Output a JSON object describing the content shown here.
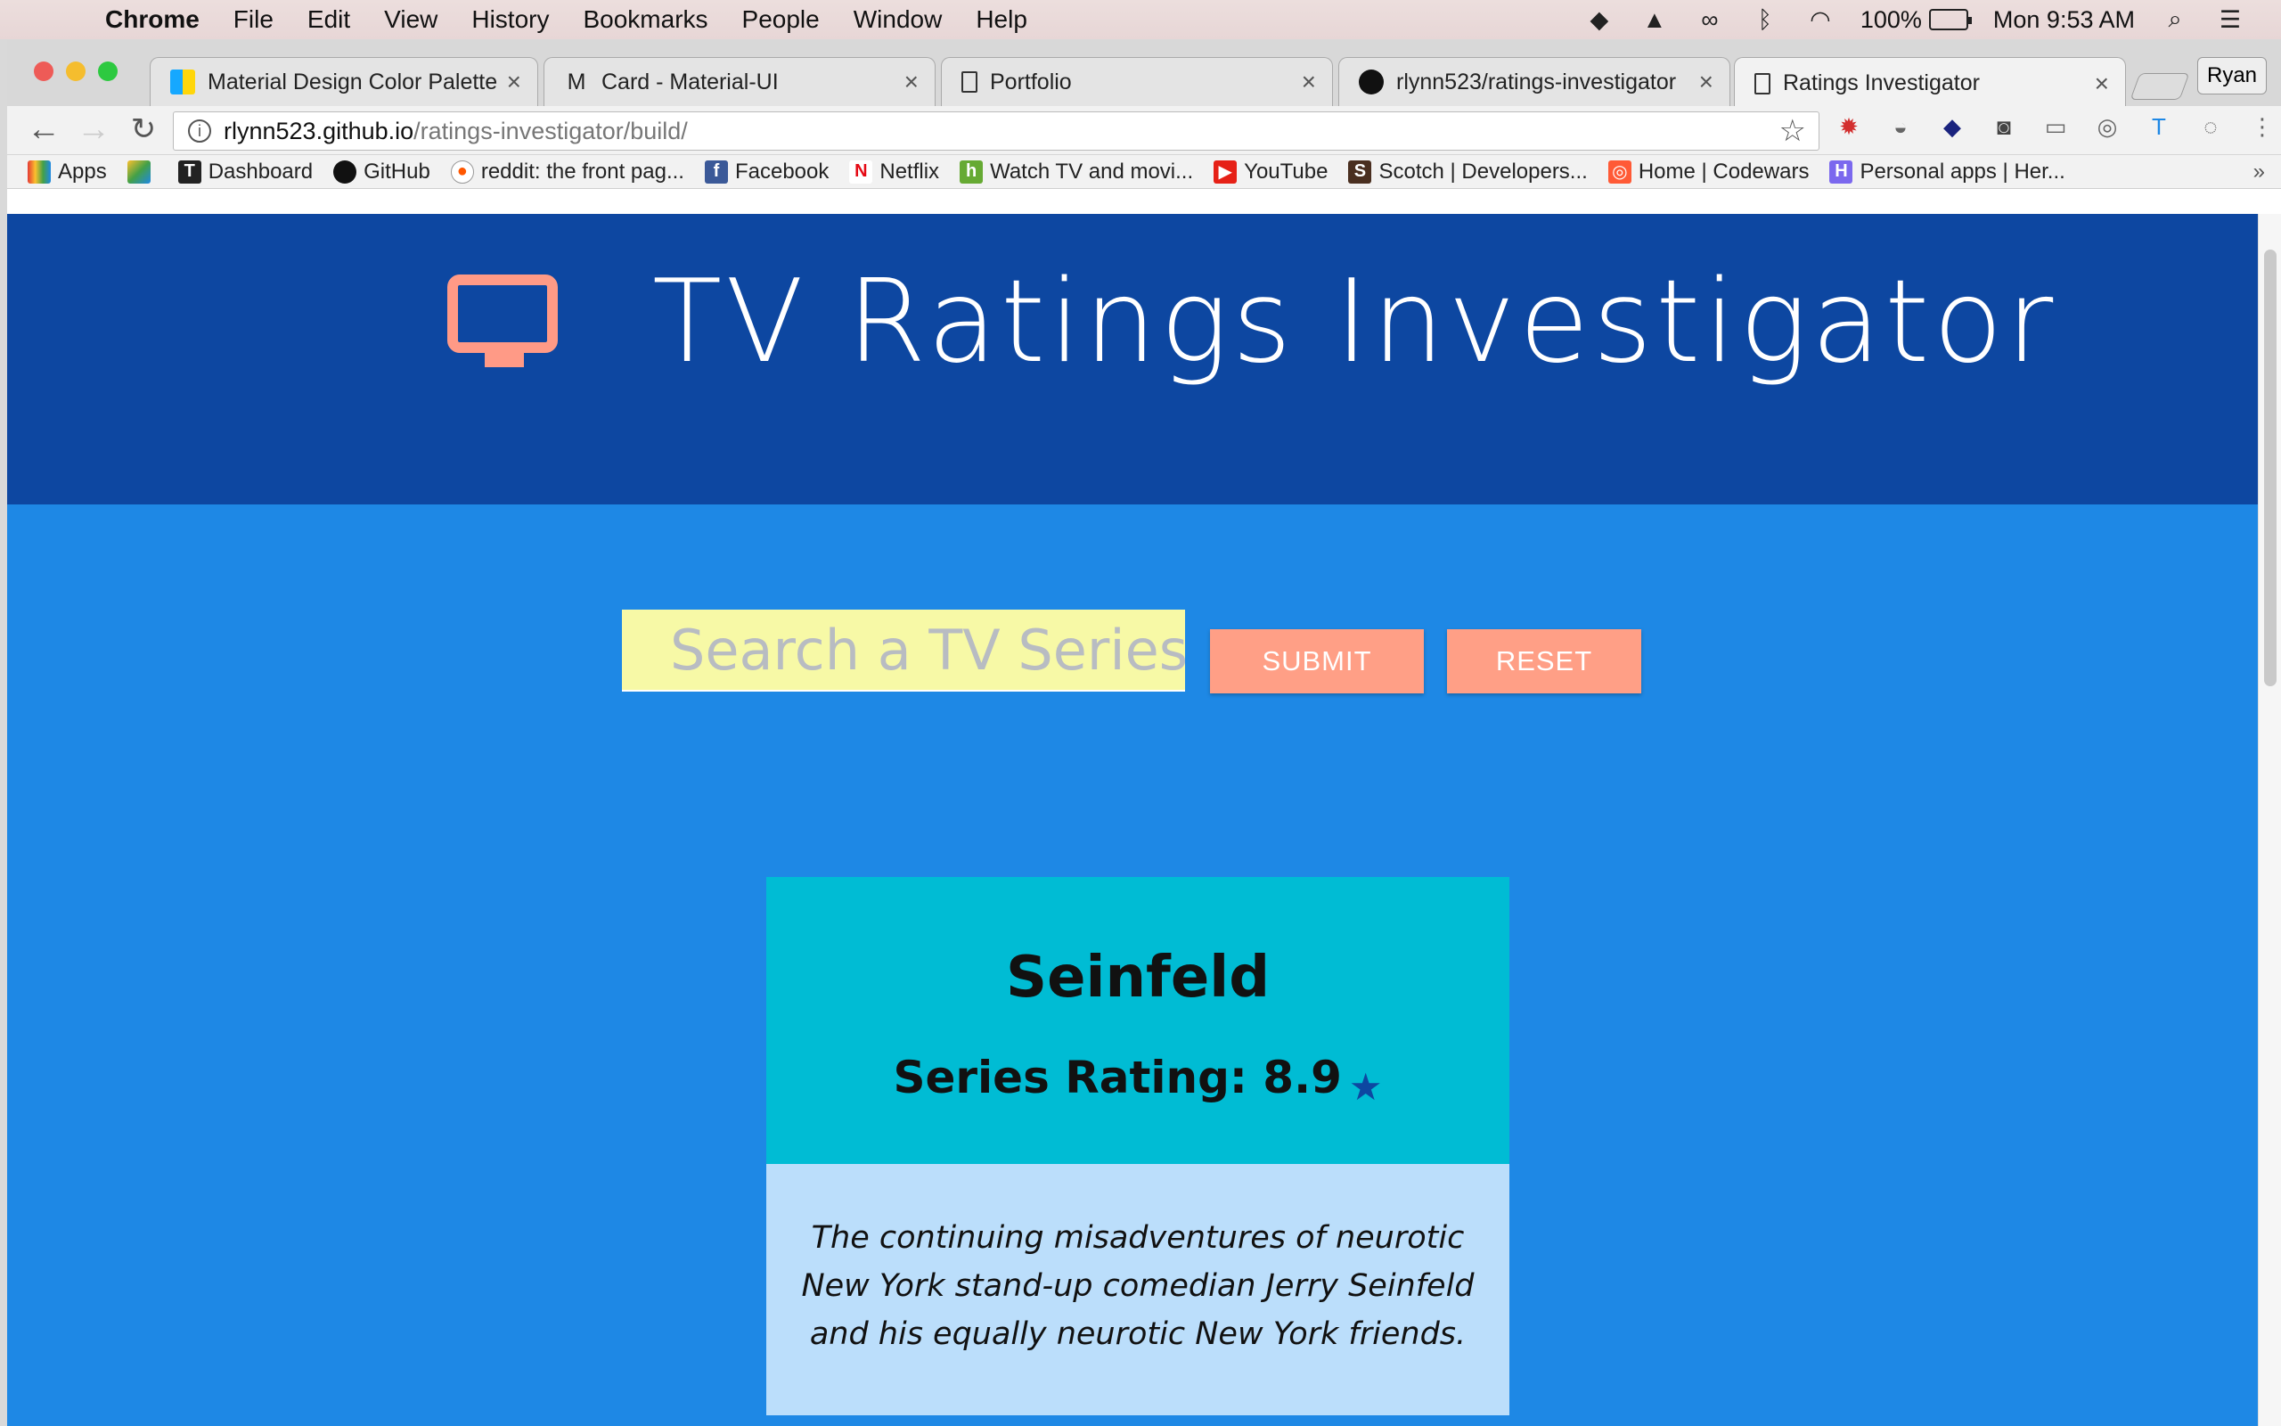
{
  "os_menu": {
    "items": [
      "Chrome",
      "File",
      "Edit",
      "View",
      "History",
      "Bookmarks",
      "People",
      "Window",
      "Help"
    ],
    "battery": "100%",
    "clock": "Mon 9:53 AM"
  },
  "browser": {
    "profile": "Ryan",
    "tabs": [
      {
        "title": "Material Design Color Palette",
        "icon": "color-palette-icon"
      },
      {
        "title": "Card - Material-UI",
        "icon": "material-ui-icon"
      },
      {
        "title": "Portfolio",
        "icon": "document-icon"
      },
      {
        "title": "rlynn523/ratings-investigator",
        "icon": "github-icon"
      },
      {
        "title": "Ratings Investigator",
        "icon": "document-icon"
      }
    ],
    "address": {
      "host": "rlynn523.github.io",
      "path": "/ratings-investigator/build/"
    },
    "bookmarks": [
      {
        "label": "Apps",
        "icon": "apps-grid-icon"
      },
      {
        "label": "",
        "icon": "google-drive-icon"
      },
      {
        "label": "Dashboard",
        "icon": "dashboard-icon"
      },
      {
        "label": "GitHub",
        "icon": "github-icon"
      },
      {
        "label": "reddit: the front pag...",
        "icon": "reddit-icon"
      },
      {
        "label": "Facebook",
        "icon": "facebook-icon"
      },
      {
        "label": "Netflix",
        "icon": "netflix-icon"
      },
      {
        "label": "Watch TV and movi...",
        "icon": "hulu-icon"
      },
      {
        "label": "YouTube",
        "icon": "youtube-icon"
      },
      {
        "label": "Scotch | Developers...",
        "icon": "scotch-icon"
      },
      {
        "label": "Home | Codewars",
        "icon": "codewars-icon"
      },
      {
        "label": "Personal apps | Her...",
        "icon": "heroku-icon"
      }
    ]
  },
  "site": {
    "title": "TV Ratings Investigator",
    "search": {
      "placeholder": "Search a TV Series",
      "value": ""
    },
    "buttons": {
      "submit": "SUBMIT",
      "reset": "RESET"
    },
    "result": {
      "title": "Seinfeld",
      "rating_label": "Series Rating: 8.9",
      "description": "The continuing misadventures of neurotic New York stand-up comedian Jerry Seinfeld and his equally neurotic New York friends."
    },
    "colors": {
      "header": "#0d47a1",
      "page": "#1e88e5",
      "accent": "#ff9f86",
      "search_bg": "#f7f9a6",
      "card_top": "#00bcd4",
      "card_bottom": "#bbdefb"
    }
  }
}
